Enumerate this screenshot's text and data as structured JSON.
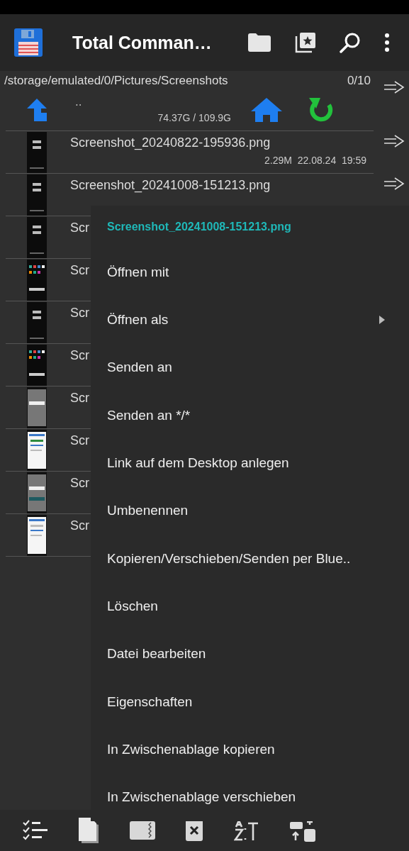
{
  "app_bar": {
    "title": "Total Comman…"
  },
  "path_bar": {
    "path": "/storage/emulated/0/Pictures/Screenshots",
    "count": "0/10"
  },
  "parent_row": {
    "name": "..",
    "space": "74.37G / 109.9G"
  },
  "files": [
    {
      "name": "Screenshot_20240822-195936.png",
      "details": "2.29M  22.08.24  19:59"
    },
    {
      "name": "Screenshot_20241008-151213.png"
    },
    {
      "name": "Scr"
    },
    {
      "name": "Scr"
    },
    {
      "name": "Scr"
    },
    {
      "name": "Scr"
    },
    {
      "name": "Scr"
    },
    {
      "name": "Scr"
    },
    {
      "name": "Scr"
    },
    {
      "name": "Scr"
    }
  ],
  "context_menu": {
    "title": "Screenshot_20241008-151213.png",
    "items": [
      {
        "label": "Öffnen mit",
        "submenu": false
      },
      {
        "label": "Öffnen als",
        "submenu": true
      },
      {
        "label": "Senden an",
        "submenu": false
      },
      {
        "label": "Senden an */*",
        "submenu": false
      },
      {
        "label": "Link auf dem Desktop anlegen",
        "submenu": false
      },
      {
        "label": "Umbenennen",
        "submenu": false
      },
      {
        "label": "Kopieren/Verschieben/Senden per Blue..",
        "submenu": false
      },
      {
        "label": "Löschen",
        "submenu": false
      },
      {
        "label": "Datei bearbeiten",
        "submenu": false
      },
      {
        "label": "Eigenschaften",
        "submenu": false
      },
      {
        "label": "In Zwischenablage kopieren",
        "submenu": false
      },
      {
        "label": "In Zwischenablage verschieben",
        "submenu": false
      }
    ]
  }
}
